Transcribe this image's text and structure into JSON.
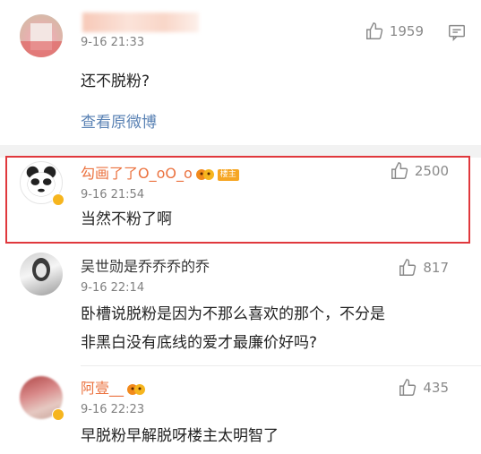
{
  "comments": [
    {
      "name": "",
      "time": "9-16 21:33",
      "text": "还不脱粉?",
      "likes": "1959",
      "view_original": "查看原微博"
    },
    {
      "name": "勾画了了O_oO_o",
      "host_badge": "楼主",
      "time": "9-16 21:54",
      "text": "当然不粉了啊",
      "likes": "2500"
    },
    {
      "name": "吴世勋是乔乔乔的乔",
      "time": "9-16 22:14",
      "text_line1": "卧槽说脱粉是因为不那么喜欢的那个，不分是",
      "text_line2": "非黑白没有底线的爱才最廉价好吗?",
      "likes": "817"
    },
    {
      "name": "阿壹__",
      "time": "9-16 22:23",
      "text": "早脱粉早解脱呀楼主太明智了",
      "likes": "435"
    }
  ],
  "colors": {
    "vip_name": "#eb7340",
    "link": "#5a82b4",
    "highlight_border": "#e0383d"
  },
  "icons": {
    "like": "thumbs-up-icon",
    "reply": "comment-icon",
    "vip_badge": "vip-crown-icon"
  }
}
